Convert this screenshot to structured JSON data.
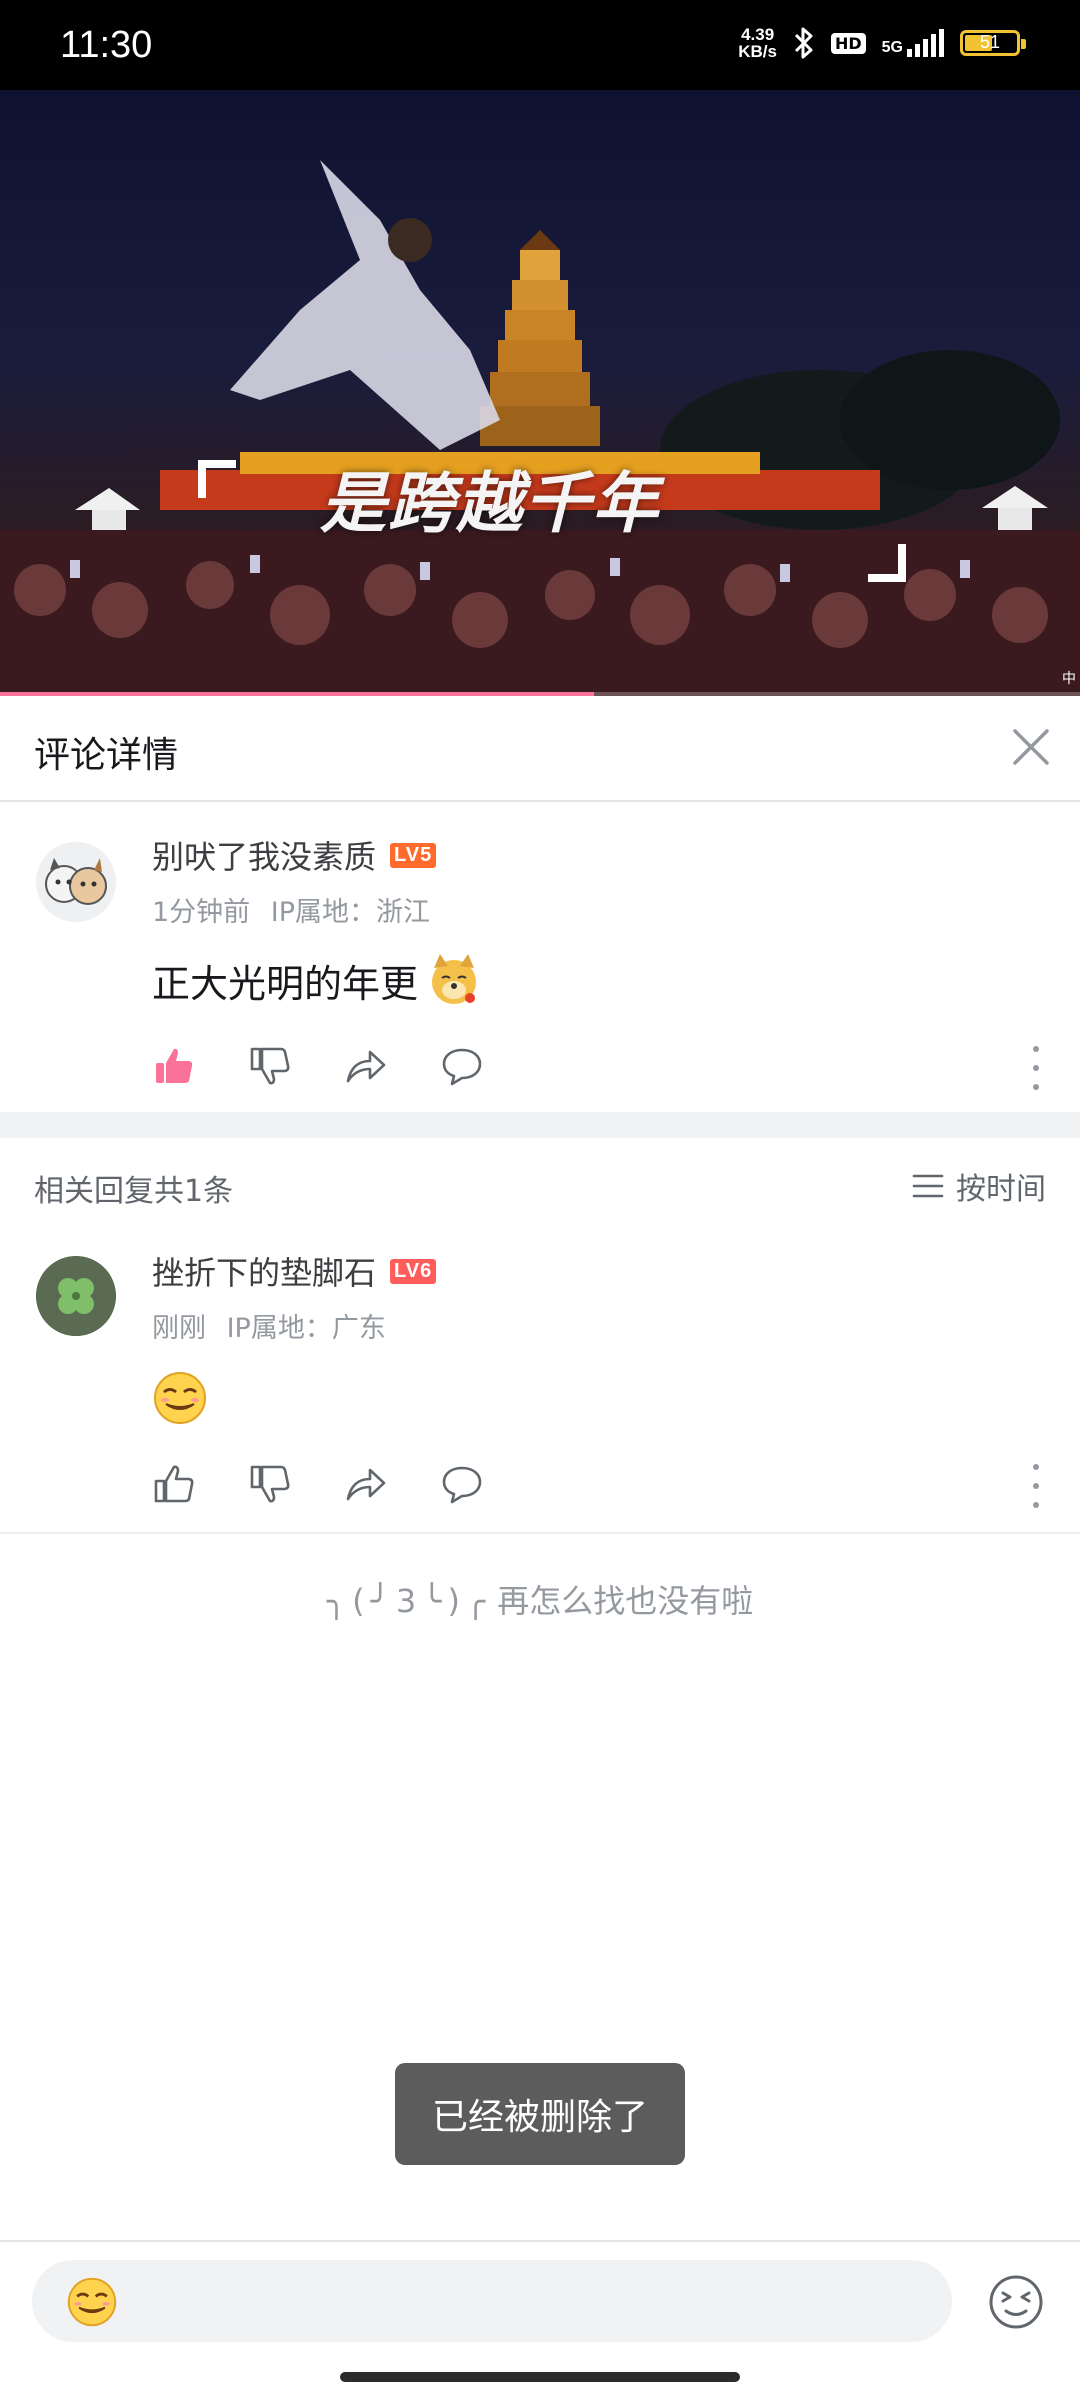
{
  "status_bar": {
    "time": "11:30",
    "net_speed_value": "4.39",
    "net_speed_unit": "KB/s",
    "hd": "HD",
    "network": "5G",
    "battery": "51"
  },
  "video": {
    "subtitle": "是跨越千年",
    "corner_text": "中",
    "progress": 0.55
  },
  "panel": {
    "title": "评论详情"
  },
  "main_comment": {
    "username": "别吠了我没素质",
    "level": "LV5",
    "time": "1分钟前",
    "ip_label": "IP属地：浙江",
    "text": "正大光明的年更",
    "liked": true
  },
  "replies": {
    "count_label": "相关回复共1条",
    "sort_label": "按时间",
    "items": [
      {
        "username": "挫折下的垫脚石",
        "level": "LV6",
        "time": "刚刚",
        "ip_label": "IP属地：广东"
      }
    ]
  },
  "end_tip": {
    "face": "╮(╯3╰)╭",
    "text": "再怎么找也没有啦"
  },
  "toast": {
    "text": "已经被删除了"
  },
  "colors": {
    "accent": "#fb7299",
    "level5": "#ff6b2c",
    "level6": "#ff5c5c"
  }
}
